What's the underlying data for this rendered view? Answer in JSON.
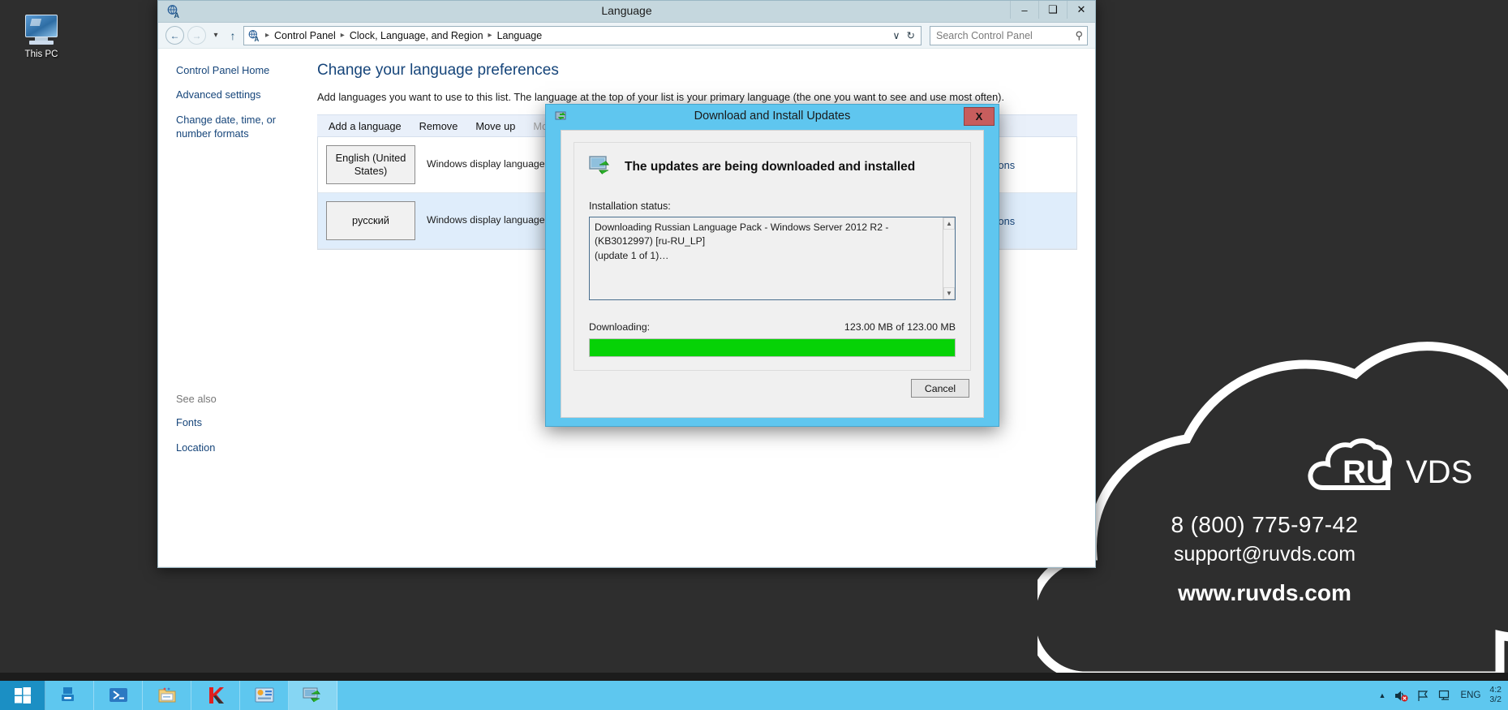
{
  "desktop": {
    "icon_label": "This PC",
    "icon_name": "this-pc-icon"
  },
  "watermark": {
    "logo_ru": "RU",
    "logo_vds": "VDS",
    "phone": "8 (800) 775-97-42",
    "email": "support@ruvds.com",
    "site": "www.ruvds.com"
  },
  "window": {
    "title": "Language",
    "minimize": "–",
    "maximize": "❑",
    "close": "✕"
  },
  "address_bar": {
    "back": "←",
    "forward": "→",
    "recent_caret": "▾",
    "up": "↑",
    "breadcrumbs": [
      "Control Panel",
      "Clock, Language, and Region",
      "Language"
    ],
    "separator": "▸",
    "dropdown": "∨",
    "refresh": "↻",
    "search_placeholder": "Search Control Panel",
    "search_value": ""
  },
  "sidebar": {
    "links": [
      "Control Panel Home",
      "Advanced settings",
      "Change date, time, or number formats"
    ],
    "see_also_header": "See also",
    "see_also_links": [
      "Fonts",
      "Location"
    ]
  },
  "content": {
    "page_title": "Change your language preferences",
    "intro": "Add languages you want to use to this list. The language at the top of your list is your primary language (the one you want to see and use most often).",
    "commands": [
      {
        "label": "Add a language",
        "disabled": false
      },
      {
        "label": "Remove",
        "disabled": false
      },
      {
        "label": "Move up",
        "disabled": false
      },
      {
        "label": "Move down",
        "disabled": true
      }
    ],
    "languages": [
      {
        "name": "English (United States)",
        "details": "Windows display language: Enabled\nKeyboard layout: US\nDate, time, and number formatting",
        "options_label": "Options",
        "selected": false
      },
      {
        "name": "русский",
        "details": "Windows display language: Available\nKeyboard layout: Russian",
        "options_label": "Options",
        "selected": true
      }
    ]
  },
  "dialog": {
    "title": "Download and Install Updates",
    "close_label": "X",
    "heading": "The updates are being downloaded and installed",
    "status_label": "Installation status:",
    "status_text": "Downloading Russian Language Pack - Windows Server 2012 R2 - (KB3012997) [ru-RU_LP]\n(update 1 of 1)…",
    "downloading_label": "Downloading:",
    "downloaded_amount": "123.00 MB of 123.00 MB",
    "progress_percent": 100,
    "progress_color": "#06d206",
    "scroll_up": "▲",
    "scroll_down": "▼",
    "cancel_label": "Cancel"
  },
  "taskbar": {
    "items": [
      "start-button",
      "server-manager",
      "powershell",
      "file-explorer",
      "kaspersky",
      "control-panel",
      "windows-update"
    ],
    "tray": {
      "show_hidden": "▲",
      "volume_muted": "volume-muted-icon",
      "flag": "action-center-icon",
      "network": "network-icon",
      "language": "ENG",
      "time": "4:2",
      "date": "3/2"
    }
  }
}
